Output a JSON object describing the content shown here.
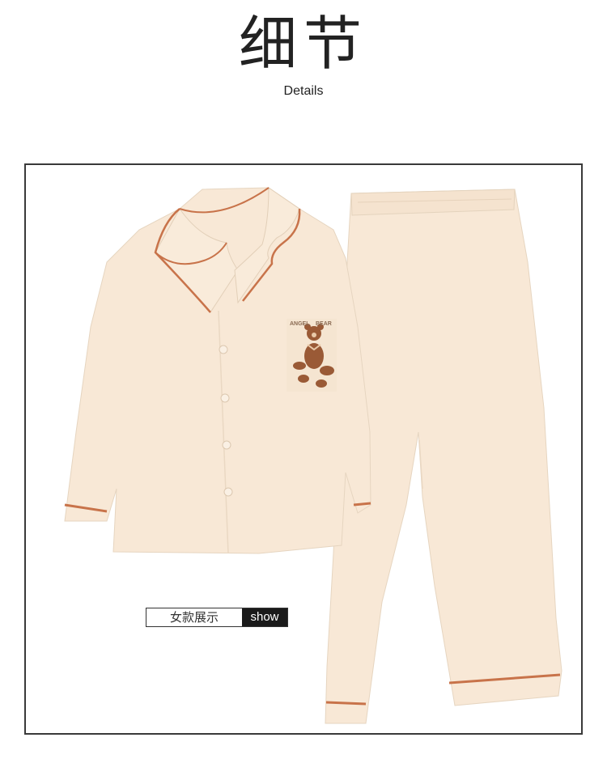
{
  "header": {
    "title_cn": "细节",
    "title_en": "Details"
  },
  "product": {
    "image_name": "pajama-set-illustration",
    "main_color": "#f8e8d6",
    "piping_color": "#c8734a",
    "print_color": "#9a5a36",
    "print_text": "ANGEL BEAR"
  },
  "badge": {
    "label_cn": "女款展示",
    "label_en": "show"
  }
}
